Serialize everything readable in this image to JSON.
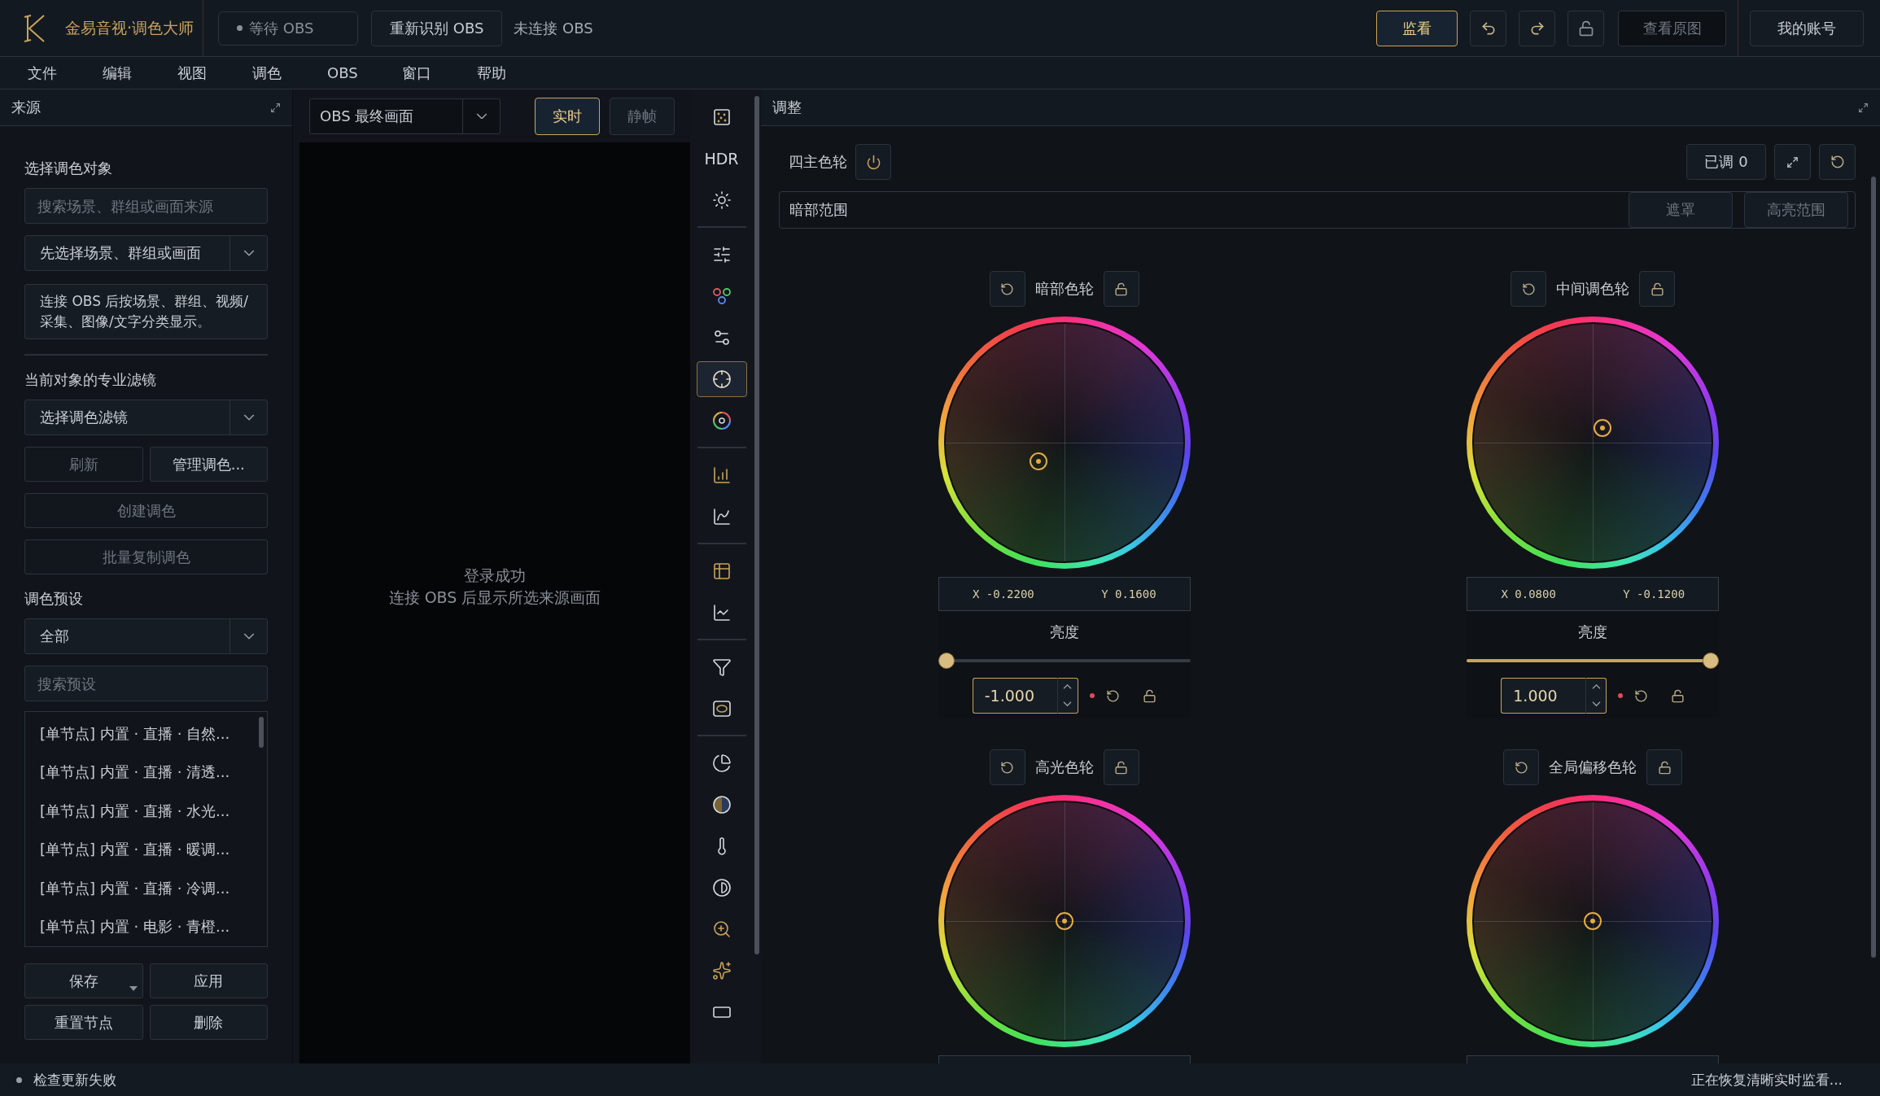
{
  "app": {
    "title": "金易音视·调色大师",
    "obs_status": "等待 OBS",
    "redetect_button": "重新识别 OBS",
    "connection": "未连接 OBS",
    "monitor_button": {
      "label": "监看",
      "active": true
    },
    "history_buttons": [
      {
        "kind": "undo"
      },
      {
        "kind": "redo"
      },
      {
        "kind": "lock"
      }
    ],
    "original_button": {
      "label": "查看原图",
      "disabled": true
    },
    "account_button": "我的账号"
  },
  "menu": [
    "文件",
    "编辑",
    "视图",
    "调色",
    "OBS",
    "窗口",
    "帮助"
  ],
  "left_panel": {
    "title": "来源",
    "object_section": {
      "heading": "选择调色对象",
      "search_placeholder": "搜索场景、群组或画面来源",
      "select_value": "先选择场景、群组或画面",
      "info": "连接 OBS 后按场景、群组、视频/采集、图像/文字分类显示。"
    },
    "filter_section": {
      "heading": "当前对象的专业滤镜",
      "select_value": "选择调色滤镜",
      "buttons": [
        {
          "label": "刷新",
          "disabled": true
        },
        {
          "label": "管理调色...",
          "disabled": false
        }
      ],
      "wide_buttons": [
        {
          "label": "创建调色",
          "disabled": true
        },
        {
          "label": "批量复制调色",
          "disabled": true
        }
      ]
    },
    "preset_section": {
      "heading": "调色预设",
      "select_value": "全部",
      "search_placeholder": "搜索预设",
      "presets": [
        "[单节点] 内置 · 直播 · 自然...",
        "[单节点] 内置 · 直播 · 清透...",
        "[单节点] 内置 · 直播 · 水光...",
        "[单节点] 内置 · 直播 · 暖调...",
        "[单节点] 内置 · 直播 · 冷调...",
        "[单节点] 内置 · 电影 · 青橙..."
      ],
      "actions": [
        {
          "label": "保存",
          "kind": "split"
        },
        {
          "label": "应用",
          "kind": "plain"
        },
        {
          "label": "重置节点",
          "kind": "plain"
        },
        {
          "label": "删除",
          "kind": "plain"
        }
      ]
    }
  },
  "preview": {
    "source_select": "OBS 最终画面",
    "modes": [
      {
        "label": "实时",
        "selected": true
      },
      {
        "label": "静帧",
        "selected": false
      }
    ],
    "message": [
      "登录成功",
      "连接 OBS 后显示所选来源画面"
    ]
  },
  "tool_groups": [
    [
      {
        "kind": "grain",
        "selected": false
      },
      {
        "kind": "text",
        "label": "HDR",
        "selected": false
      },
      {
        "kind": "light",
        "selected": false
      }
    ],
    [
      {
        "kind": "sliders",
        "selected": false
      },
      {
        "kind": "rgb",
        "selected": false
      },
      {
        "kind": "tune",
        "selected": false
      },
      {
        "kind": "wheels",
        "selected": true
      },
      {
        "kind": "colorwheel",
        "selected": false
      }
    ],
    [
      {
        "kind": "bars",
        "selected": false
      },
      {
        "kind": "curve",
        "selected": false
      }
    ],
    [
      {
        "kind": "layout",
        "selected": false
      },
      {
        "kind": "scope",
        "selected": false
      }
    ],
    [
      {
        "kind": "filter",
        "selected": false
      },
      {
        "kind": "mask",
        "selected": false
      }
    ],
    [
      {
        "kind": "pie",
        "selected": false
      },
      {
        "kind": "halftone",
        "selected": false
      },
      {
        "kind": "temperature",
        "selected": false
      },
      {
        "kind": "contrast",
        "selected": false
      },
      {
        "kind": "zoom",
        "selected": false
      },
      {
        "kind": "sparkle",
        "selected": false
      },
      {
        "kind": "frame",
        "selected": false
      }
    ]
  ],
  "adjust": {
    "title": "调整",
    "module": {
      "title": "四主色轮",
      "enabled": true
    },
    "adjusted_badge": "已调 0",
    "range": {
      "label": "暗部范围",
      "buttons": [
        "遮罩",
        "高亮范围"
      ]
    },
    "wheels": [
      {
        "title": "暗部色轮",
        "x_label": "X",
        "x_value": "-0.2200",
        "y_label": "Y",
        "y_value": "0.1600",
        "brightness_label": "亮度",
        "level": 0,
        "value": "-1.000"
      },
      {
        "title": "中间调色轮",
        "x_label": "X",
        "x_value": "0.0800",
        "y_label": "Y",
        "y_value": "-0.1200",
        "brightness_label": "亮度",
        "level": 1,
        "value": "1.000"
      },
      {
        "title": "高光色轮"
      },
      {
        "title": "全局偏移色轮"
      }
    ]
  },
  "status_bar": {
    "left": "检查更新失败",
    "right": "正在恢复清晰实时监看..."
  }
}
